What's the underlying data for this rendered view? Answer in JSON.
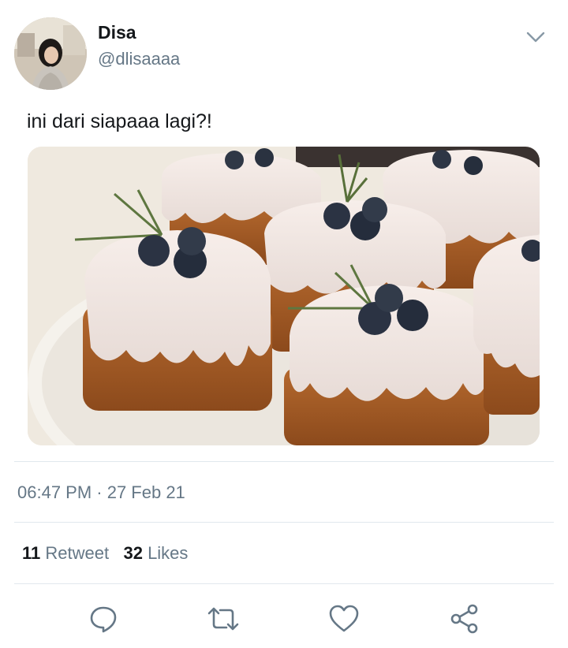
{
  "user": {
    "display_name": "Disa",
    "handle": "@dlisaaaa"
  },
  "tweet": {
    "text": "ini dari siapaaa lagi?!",
    "timestamp": "06:47 PM · 27 Feb 21"
  },
  "stats": {
    "retweet_count": "11",
    "retweet_label": "Retweet",
    "like_count": "32",
    "like_label": "Likes"
  },
  "icons": {
    "menu": "chevron-down-icon",
    "reply": "reply-icon",
    "retweet": "retweet-icon",
    "like": "heart-icon",
    "share": "share-icon"
  },
  "colors": {
    "text_primary": "#14171a",
    "text_secondary": "#657786",
    "divider": "#e1e8ed"
  }
}
